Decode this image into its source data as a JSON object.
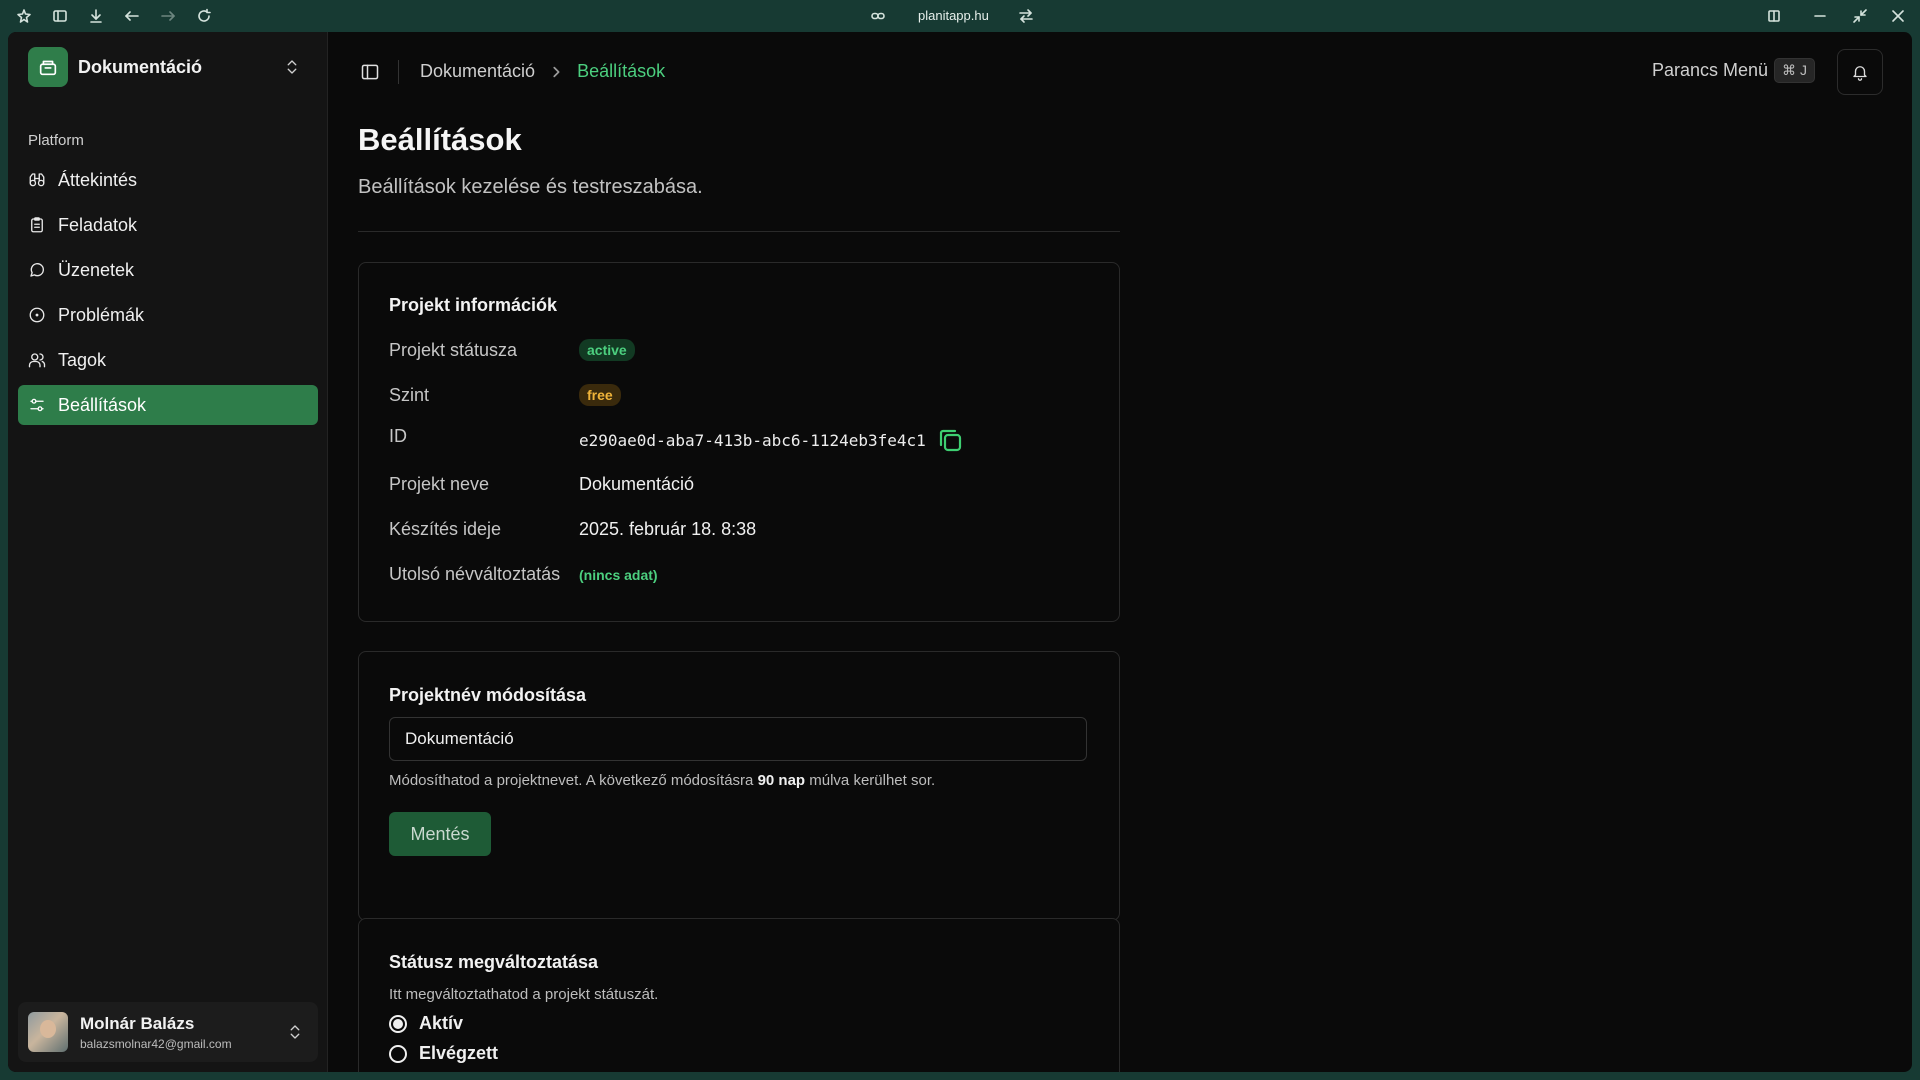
{
  "browser": {
    "url": "planitapp.hu"
  },
  "sidebar": {
    "project_name": "Dokumentáció",
    "section_label": "Platform",
    "items": [
      {
        "label": "Áttekintés",
        "icon": "binoculars-icon"
      },
      {
        "label": "Feladatok",
        "icon": "clipboard-icon"
      },
      {
        "label": "Üzenetek",
        "icon": "message-circle-icon"
      },
      {
        "label": "Problémák",
        "icon": "alert-circle-icon"
      },
      {
        "label": "Tagok",
        "icon": "users-icon"
      },
      {
        "label": "Beállítások",
        "icon": "settings-sliders-icon",
        "active": true
      }
    ],
    "user": {
      "name": "Molnár Balázs",
      "email": "balazsmolnar42@gmail.com"
    }
  },
  "header": {
    "breadcrumb": [
      "Dokumentáció",
      "Beállítások"
    ],
    "command_label": "Parancs Menü",
    "command_shortcut": "⌘ J"
  },
  "page": {
    "title": "Beállítások",
    "subtitle": "Beállítások kezelése és testreszabása."
  },
  "project_info": {
    "title": "Projekt információk",
    "rows": {
      "status_label": "Projekt státusza",
      "status_value": "active",
      "tier_label": "Szint",
      "tier_value": "free",
      "id_label": "ID",
      "id_value": "e290ae0d-aba7-413b-abc6-1124eb3fe4c1",
      "name_label": "Projekt neve",
      "name_value": "Dokumentáció",
      "created_label": "Készítés ideje",
      "created_value": "2025. február 18. 8:38",
      "renamed_label": "Utolsó névváltoztatás",
      "renamed_value": "(nincs adat)"
    }
  },
  "rename": {
    "title": "Projektnév módosítása",
    "input_value": "Dokumentáció",
    "help_before": "Módosíthatod a projektnevet. A következő módosításra ",
    "help_bold": "90 nap",
    "help_after": " múlva kerülhet sor.",
    "save_label": "Mentés"
  },
  "status_change": {
    "title": "Státusz megváltoztatása",
    "description": "Itt megváltoztathatod a projekt státuszát.",
    "options": [
      {
        "label": "Aktív",
        "selected": true
      },
      {
        "label": "Elvégzett",
        "selected": false
      }
    ]
  },
  "colors": {
    "accent": "#2e7d4a",
    "accent_text": "#4ccf7f",
    "warning": "#f0b43a",
    "background": "#0a0a0a",
    "sidebar": "#141414",
    "chrome": "#173a33"
  }
}
